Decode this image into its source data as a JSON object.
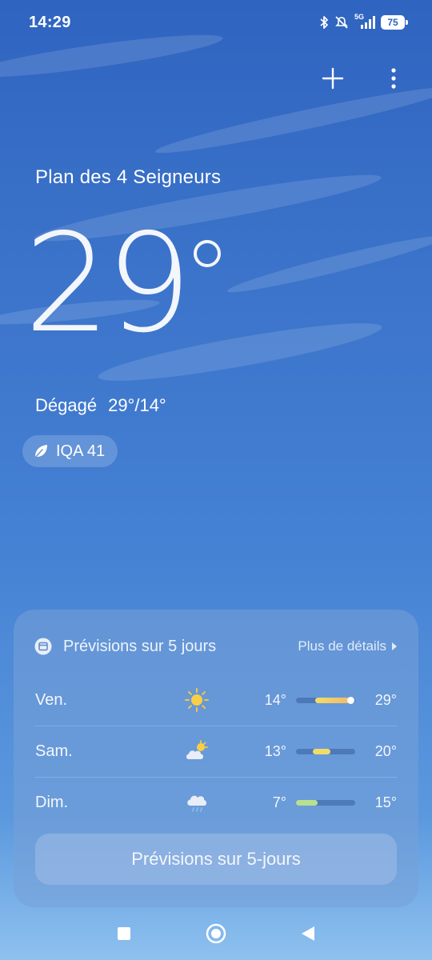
{
  "status_bar": {
    "time": "14:29",
    "network": "5G",
    "battery": "75",
    "icons": [
      "bluetooth-icon",
      "mute-icon",
      "signal-icon",
      "battery-icon"
    ]
  },
  "toolbar": {
    "add_icon": "plus-icon",
    "menu_icon": "more-vertical-icon"
  },
  "weather": {
    "location": "Plan des 4 Seigneurs",
    "temperature": "29",
    "condition": "Dégagé",
    "high_low": "29°/14°",
    "aqi_label": "IQA 41"
  },
  "forecast": {
    "title": "Prévisions sur 5 jours",
    "more_details": "Plus de détails",
    "button_label": "Prévisions sur 5-jours",
    "days": [
      {
        "day": "Ven.",
        "icon": "sunny-icon",
        "low": "14°",
        "high": "29°",
        "range_start": 0.32,
        "range_end": 0.93,
        "current_dot": true
      },
      {
        "day": "Sam.",
        "icon": "partly-cloudy-icon",
        "low": "13°",
        "high": "20°",
        "range_start": 0.28,
        "range_end": 0.58,
        "current_dot": false
      },
      {
        "day": "Dim.",
        "icon": "rain-icon",
        "low": "7°",
        "high": "15°",
        "range_start": 0.0,
        "range_end": 0.36,
        "current_dot": false
      }
    ]
  },
  "colors": {
    "sky_top": "#2f64c0",
    "sky_bottom": "#8ec1ef",
    "bar_warm": "#f2b86b",
    "bar_mild": "#f1dc6a",
    "bar_cool": "#b8e08e"
  }
}
